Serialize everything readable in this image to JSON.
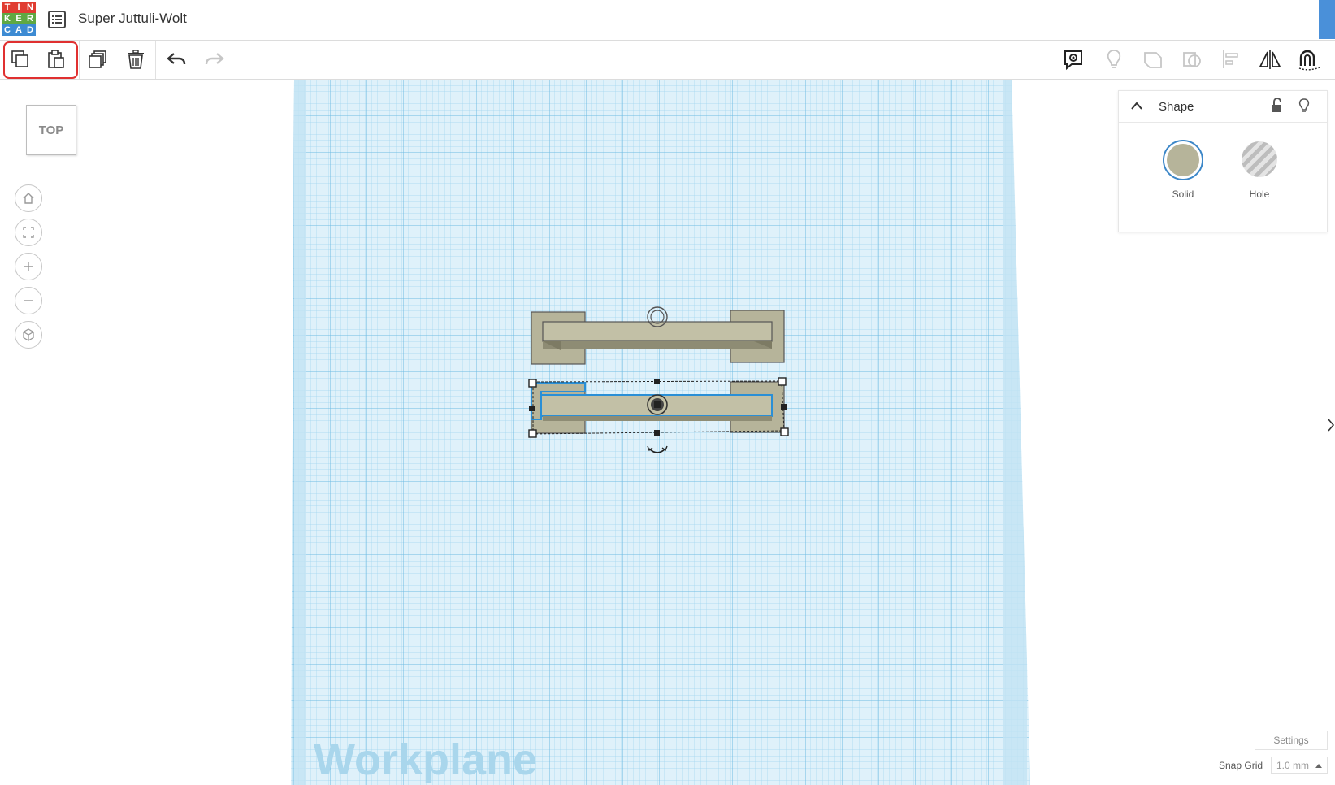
{
  "app": {
    "logo_letters": [
      "T",
      "I",
      "N",
      "K",
      "E",
      "R",
      "C",
      "A",
      "D"
    ],
    "logo_colors": [
      "#e03c31",
      "#e03c31",
      "#e03c31",
      "#5fa843",
      "#5fa843",
      "#5fa843",
      "#3d8bd3",
      "#3d8bd3",
      "#3d8bd3"
    ],
    "title": "Super Juttuli-Wolt"
  },
  "toolbar": {
    "left_buttons": [
      "copy-icon",
      "paste-icon",
      "duplicate-icon",
      "trash-icon",
      "undo-icon",
      "redo-icon"
    ],
    "right_buttons": [
      "notes-icon",
      "lightbulb-icon",
      "group-icon",
      "ungroup-icon",
      "align-icon",
      "mirror-icon",
      "magnet-icon"
    ],
    "highlight_color": "#e03030"
  },
  "viewcube": {
    "label": "TOP"
  },
  "nav_buttons": [
    "home-icon",
    "fit-icon",
    "zoom-in-icon",
    "zoom-out-icon",
    "perspective-icon"
  ],
  "workplane": {
    "label": "Workplane",
    "grid_color": "#7cc4e8",
    "background": "#dff1fa"
  },
  "shape_panel": {
    "title": "Shape",
    "solid_label": "Solid",
    "hole_label": "Hole",
    "solid_color": "#b6b49a",
    "selected_ring": "#3c87c8"
  },
  "footer": {
    "settings_label": "Settings",
    "snap_grid_label": "Snap Grid",
    "snap_grid_value": "1.0 mm"
  }
}
